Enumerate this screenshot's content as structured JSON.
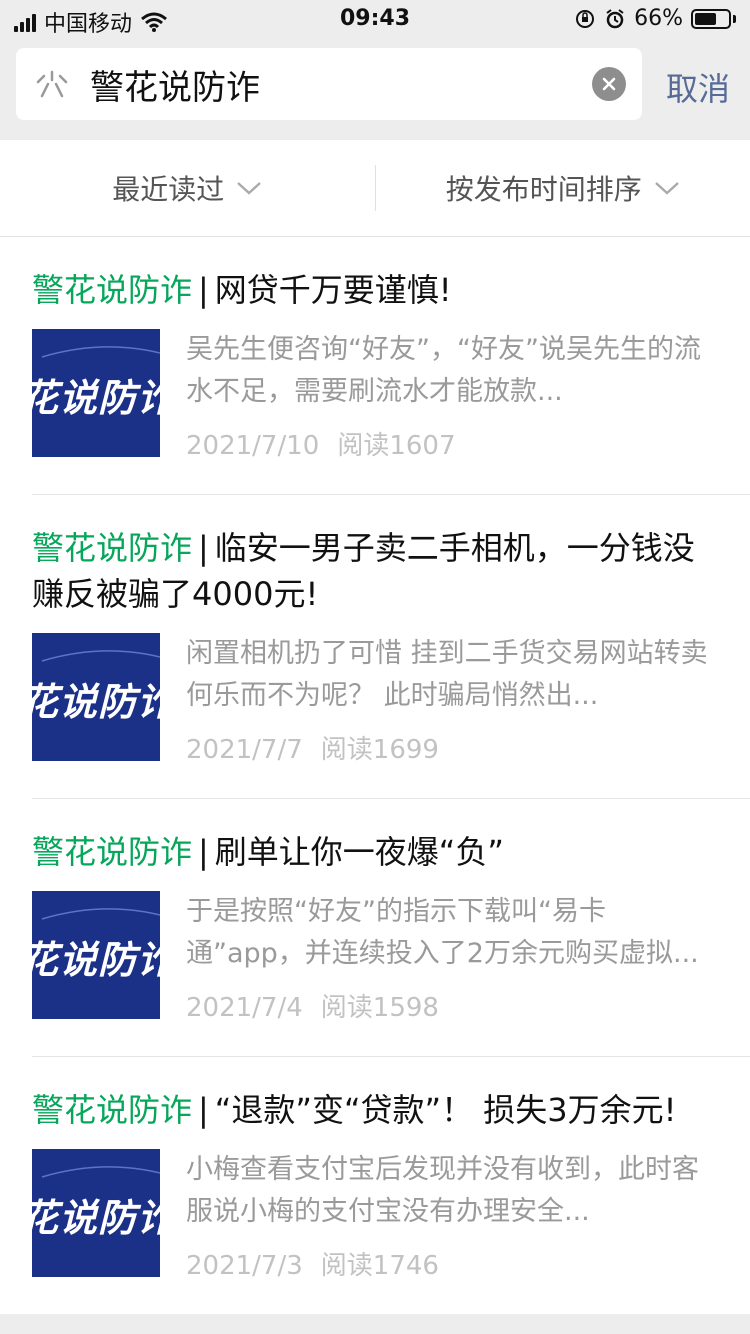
{
  "status_bar": {
    "carrier": "中国移动",
    "time": "09:43",
    "battery_percent": "66%",
    "battery_level": 0.66
  },
  "search": {
    "query": "警花说防诈",
    "cancel_label": "取消"
  },
  "filters": {
    "left_label": "最近读过",
    "right_label": "按发布时间排序"
  },
  "articles": [
    {
      "source": "警花说防诈",
      "separator": "|",
      "title": "网贷千万要谨慎!",
      "thumb_text": "花说防诈",
      "digest": "吴先生便咨询“好友”，“好友”说吴先生的流水不足，需要刷流水才能放款...",
      "date": "2021/7/10",
      "reads": "阅读1607"
    },
    {
      "source": "警花说防诈",
      "separator": "|",
      "title": "临安一男子卖二手相机，一分钱没赚反被骗了4000元!",
      "thumb_text": "花说防诈",
      "digest": "闲置相机扔了可惜 挂到二手货交易网站转卖 何乐而不为呢？ 此时骗局悄然出...",
      "date": "2021/7/7",
      "reads": "阅读1699"
    },
    {
      "source": "警花说防诈",
      "separator": "|",
      "title": "刷单让你一夜爆“负”",
      "thumb_text": "花说防诈",
      "digest": "于是按照“好友”的指示下载叫“易卡通”app，并连续投入了2万余元购买虚拟...",
      "date": "2021/7/4",
      "reads": "阅读1598"
    },
    {
      "source": "警花说防诈",
      "separator": "|",
      "title": "“退款”变“贷款”！ 损失3万余元!",
      "thumb_text": "花说防诈",
      "digest": "小梅查看支付宝后发现并没有收到，此时客服说小梅的支付宝没有办理安全...",
      "date": "2021/7/3",
      "reads": "阅读1746"
    }
  ],
  "colors": {
    "accent_link": "#576b95",
    "source_green": "#07a65b",
    "thumb_blue": "#1b3187"
  }
}
